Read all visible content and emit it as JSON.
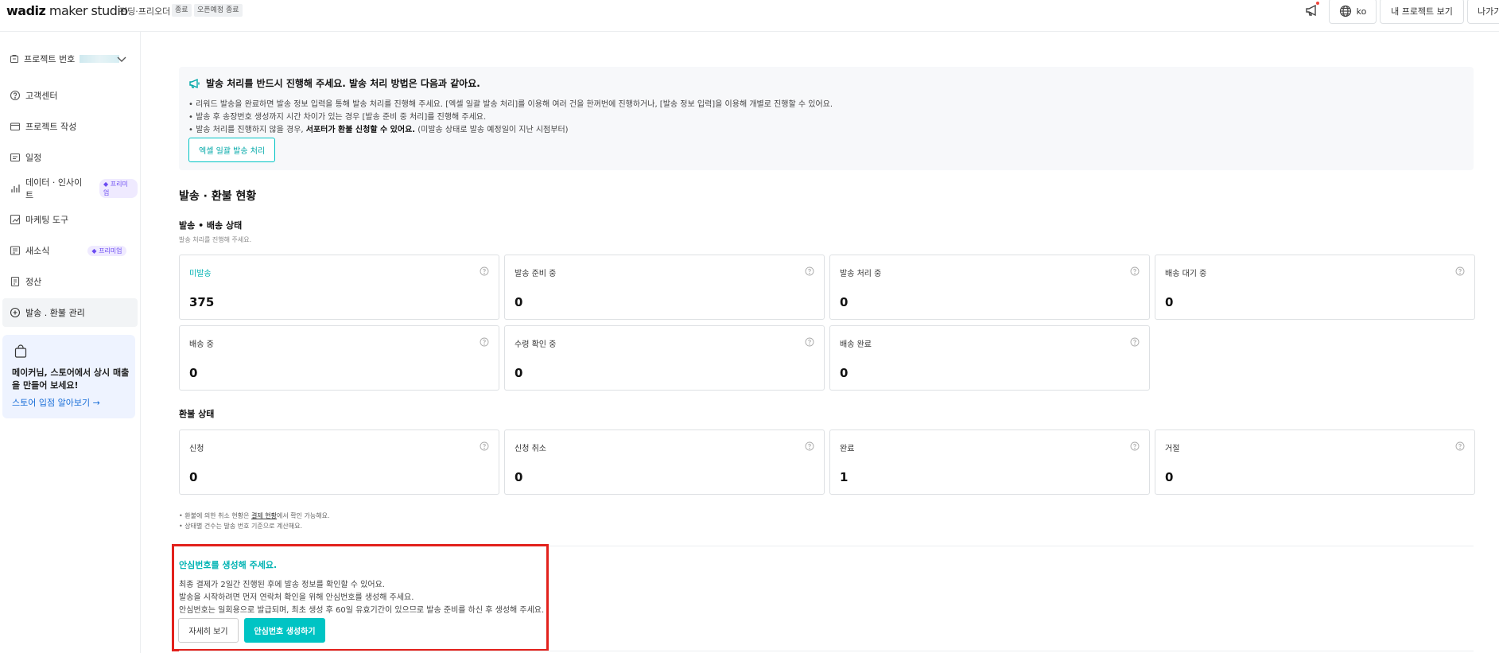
{
  "header": {
    "logo_main": "wadiz",
    "logo_sub": " maker studio",
    "subtitle": "펀딩·프리오더",
    "pill_end": "종료",
    "pill_open_end": "오픈예정 종료",
    "lang": "ko",
    "my_project_label": "내 프로젝트 보기",
    "exit_label": "나가기"
  },
  "sidebar": {
    "project_label": "프로젝트 번호",
    "items": [
      {
        "label": "고객센터"
      },
      {
        "label": "프로젝트 작성"
      },
      {
        "label": "일정"
      },
      {
        "label": "데이터 · 인사이트",
        "badge": "프리미엄"
      },
      {
        "label": "마케팅 도구"
      },
      {
        "label": "새소식",
        "badge": "프리미엄"
      },
      {
        "label": "정산"
      },
      {
        "label": "발송 . 환불 관리"
      }
    ],
    "promo": {
      "text": "메이커님, 스토어에서 상시 매출을 만들어 보세요!",
      "link": "스토어 입점 알아보기 →"
    }
  },
  "notice": {
    "title": "발송 처리를 반드시 진행해 주세요. 발송 처리 방법은 다음과 같아요.",
    "line1": "• 리워드 발송을 완료하면 발송 정보 입력을 통해 발송 처리를 진행해 주세요. [엑셀 일괄 발송 처리]를 이용해 여러 건을 한꺼번에 진행하거나, [발송 정보 입력]을 이용해 개별로 진행할 수 있어요.",
    "line2": "• 발송 후 송장번호 생성까지 시간 차이가 있는 경우 [발송 준비 중 처리]를 진행해 주세요.",
    "line3_pre": "• 발송 처리를 진행하지 않을 경우, ",
    "line3_bold": "서포터가 환불 신청할 수 있어요.",
    "line3_post": " (미발송 상태로 발송 예정일이 지난 시점부터)",
    "button": "엑셀 일괄 발송 처리"
  },
  "section_title": "발송 · 환불 현황",
  "shipping": {
    "title": "발송 • 배송 상태",
    "desc": "발송 처리를 진행해 주세요.",
    "cards": [
      {
        "label": "미발송",
        "value": "375"
      },
      {
        "label": "발송 준비 중",
        "value": "0"
      },
      {
        "label": "발송 처리 중",
        "value": "0"
      },
      {
        "label": "배송 대기 중",
        "value": "0"
      },
      {
        "label": "배송 중",
        "value": "0"
      },
      {
        "label": "수령 확인 중",
        "value": "0"
      },
      {
        "label": "배송 완료",
        "value": "0"
      }
    ]
  },
  "refund": {
    "title": "환불 상태",
    "cards": [
      {
        "label": "신청",
        "value": "0"
      },
      {
        "label": "신청 취소",
        "value": "0"
      },
      {
        "label": "완료",
        "value": "1"
      },
      {
        "label": "거절",
        "value": "0"
      }
    ]
  },
  "notes": {
    "n1_pre": "• 환불에 의한 취소 현황은 ",
    "n1_link": "결제 현황",
    "n1_post": "에서 확인 가능해요.",
    "n2": "• 상태별 건수는 발송 번호 기준으로 계산해요."
  },
  "safe_number": {
    "title": "안심번호를 생성해 주세요.",
    "line1": "최종 결제가 2일간 진행된 후에 발송 정보를 확인할 수 있어요.",
    "line2": "발송을 시작하려면 먼저 연락처 확인을 위해 안심번호를 생성해 주세요.",
    "line3": "안심번호는 일회용으로 발급되며, 최초 생성 후 60일 유효기간이 있으므로 발송 준비를 하신 후 생성해 주세요.",
    "detail_button": "자세히 보기",
    "generate_button": "안심번호 생성하기"
  },
  "colors": {
    "accent": "#00c4c4",
    "alert_border": "#e2211c",
    "premium": "#6c4cf2"
  }
}
